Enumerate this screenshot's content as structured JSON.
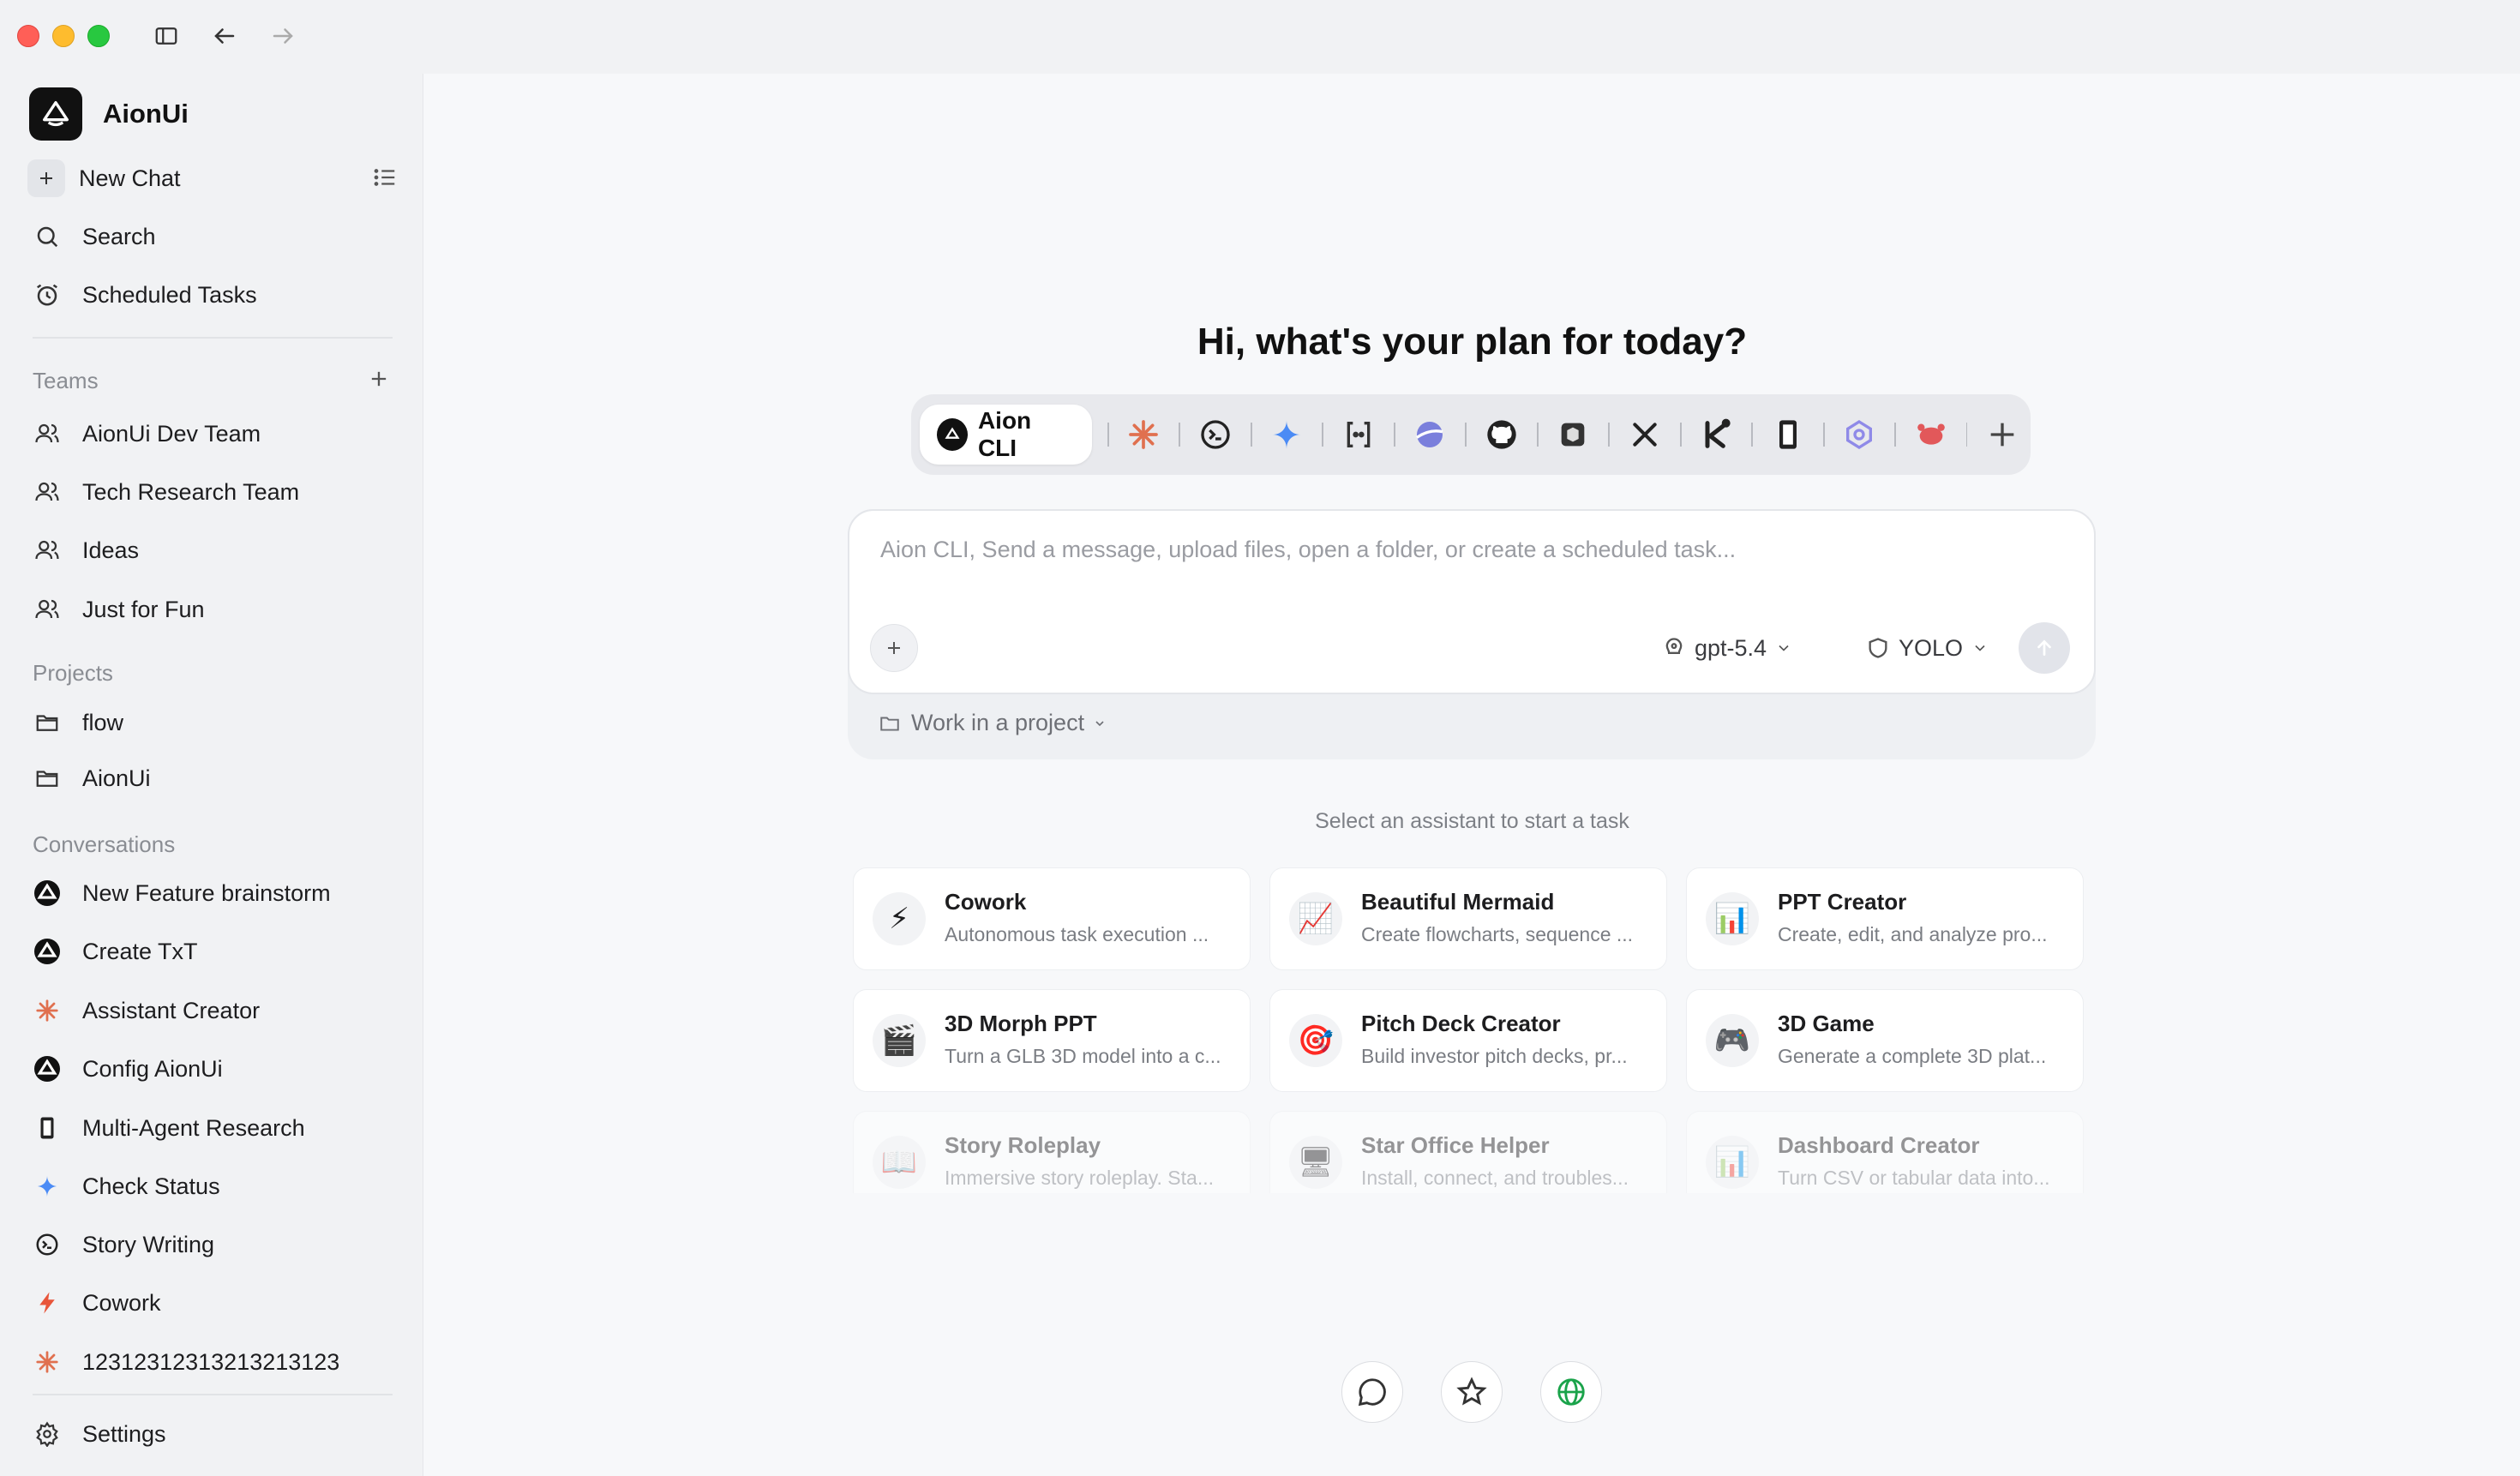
{
  "app": {
    "name": "AionUi"
  },
  "sidebar": {
    "new_chat": "New Chat",
    "search": "Search",
    "scheduled": "Scheduled Tasks",
    "teams_label": "Teams",
    "teams": [
      "AionUi Dev Team",
      "Tech Research Team",
      "Ideas",
      "Just for Fun"
    ],
    "projects_label": "Projects",
    "projects": [
      "flow",
      "AionUi"
    ],
    "conversations_label": "Conversations",
    "conversations": [
      {
        "label": "New Feature brainstorm",
        "icon": "aion-icon"
      },
      {
        "label": "Create TxT",
        "icon": "aion-icon"
      },
      {
        "label": "Assistant Creator",
        "icon": "claude-icon"
      },
      {
        "label": "Config AionUi",
        "icon": "aion-icon"
      },
      {
        "label": "Multi-Agent Research",
        "icon": "device-icon"
      },
      {
        "label": "Check Status",
        "icon": "gemini-icon"
      },
      {
        "label": "Story Writing",
        "icon": "terminal-icon"
      },
      {
        "label": "Cowork",
        "icon": "lightning-icon"
      },
      {
        "label": "12312312313213213123",
        "icon": "claude-icon"
      }
    ],
    "settings": "Settings"
  },
  "main": {
    "title": "Hi, what's your plan for today?",
    "active_agent": "Aion CLI",
    "composer": {
      "placeholder": "Aion CLI, Send a message, upload files, open a folder, or create a scheduled task...",
      "model": "gpt-5.4",
      "mode": "YOLO",
      "work_in_project": "Work in a project"
    },
    "assistant_hint": "Select an assistant to start a task",
    "assistants": [
      {
        "emoji": "⚡",
        "title": "Cowork",
        "desc": "Autonomous task execution ..."
      },
      {
        "emoji": "📈",
        "title": "Beautiful Mermaid",
        "desc": "Create flowcharts, sequence ..."
      },
      {
        "emoji": "📊",
        "title": "PPT Creator",
        "desc": "Create, edit, and analyze pro..."
      },
      {
        "emoji": "🎬",
        "title": "3D Morph PPT",
        "desc": "Turn a GLB 3D model into a c..."
      },
      {
        "emoji": "🎯",
        "title": "Pitch Deck Creator",
        "desc": "Build investor pitch decks, pr..."
      },
      {
        "emoji": "🎮",
        "title": "3D Game",
        "desc": "Generate a complete 3D plat..."
      },
      {
        "emoji": "📖",
        "title": "Story Roleplay",
        "desc": "Immersive story roleplay. Sta..."
      },
      {
        "emoji": "🖥",
        "title": "Star Office Helper",
        "desc": "Install, connect, and troubles..."
      },
      {
        "emoji": "📊",
        "title": "Dashboard Creator",
        "desc": "Turn CSV or tabular data into..."
      }
    ]
  },
  "colors": {
    "accent": "#111111",
    "claude": "#e0704f",
    "globe": "#1aa34a"
  }
}
